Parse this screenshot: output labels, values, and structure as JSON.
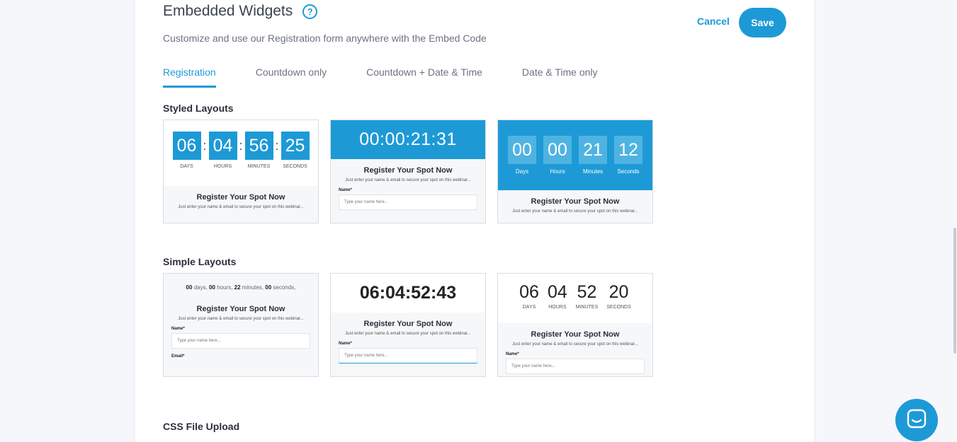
{
  "header": {
    "title": "Embedded Widgets",
    "subtitle": "Customize and use our Registration form anywhere with the Embed Code",
    "cancel_label": "Cancel",
    "save_label": "Save"
  },
  "tabs": [
    {
      "label": "Registration",
      "active": true
    },
    {
      "label": "Countdown only"
    },
    {
      "label": "Countdown + Date & Time"
    },
    {
      "label": "Date & Time only"
    }
  ],
  "styled": {
    "label": "Styled Layouts",
    "card1": {
      "d": [
        "06",
        "04",
        "56",
        "25"
      ],
      "l": [
        "DAYS",
        "HOURS",
        "MINUTES",
        "SECONDS"
      ],
      "reg": "Register Your Spot Now",
      "sub": "Just enter your name & email to secure your spot on this webinar..."
    },
    "card2": {
      "time": "00:00:21:31",
      "reg": "Register Your Spot Now",
      "sub": "Just enter your name & email to secure your spot on this webinar...",
      "name_label": "Name*",
      "placeholder": "Type your name here..."
    },
    "card3": {
      "d": [
        "00",
        "00",
        "21",
        "12"
      ],
      "l": [
        "Days",
        "Hours",
        "Minutes",
        "Seconds"
      ],
      "reg": "Register Your Spot Now",
      "sub": "Just enter your name & email to secure your spot on this webinar..."
    }
  },
  "simple": {
    "label": "Simple Layouts",
    "card1": {
      "d": [
        "00",
        "00",
        "22",
        "00"
      ],
      "u": [
        "days,",
        "hours,",
        "minutes,",
        "seconds,"
      ],
      "reg": "Register Your Spot Now",
      "sub": "Just enter your name & email to secure your spot on this webinar...",
      "name_label": "Name*",
      "placeholder": "Type your name here...",
      "email_label": "Email*"
    },
    "card2": {
      "time": "06:04:52:43",
      "reg": "Register Your Spot Now",
      "sub": "Just enter your name & email to secure your spot on this webinar...",
      "name_label": "Name*",
      "placeholder": "Type your name here..."
    },
    "card3": {
      "d": [
        "06",
        "04",
        "52",
        "20"
      ],
      "l": [
        "DAYS",
        "HOURS",
        "MINUTES",
        "SECONDS"
      ],
      "reg": "Register Your Spot Now",
      "sub": "Just enter your name & email to secure your spot on this webinar...",
      "name_label": "Name*",
      "placeholder": "Type your name here..."
    }
  },
  "css_upload": {
    "label": "CSS File Upload"
  },
  "colors": {
    "accent": "#1d9ad6"
  }
}
